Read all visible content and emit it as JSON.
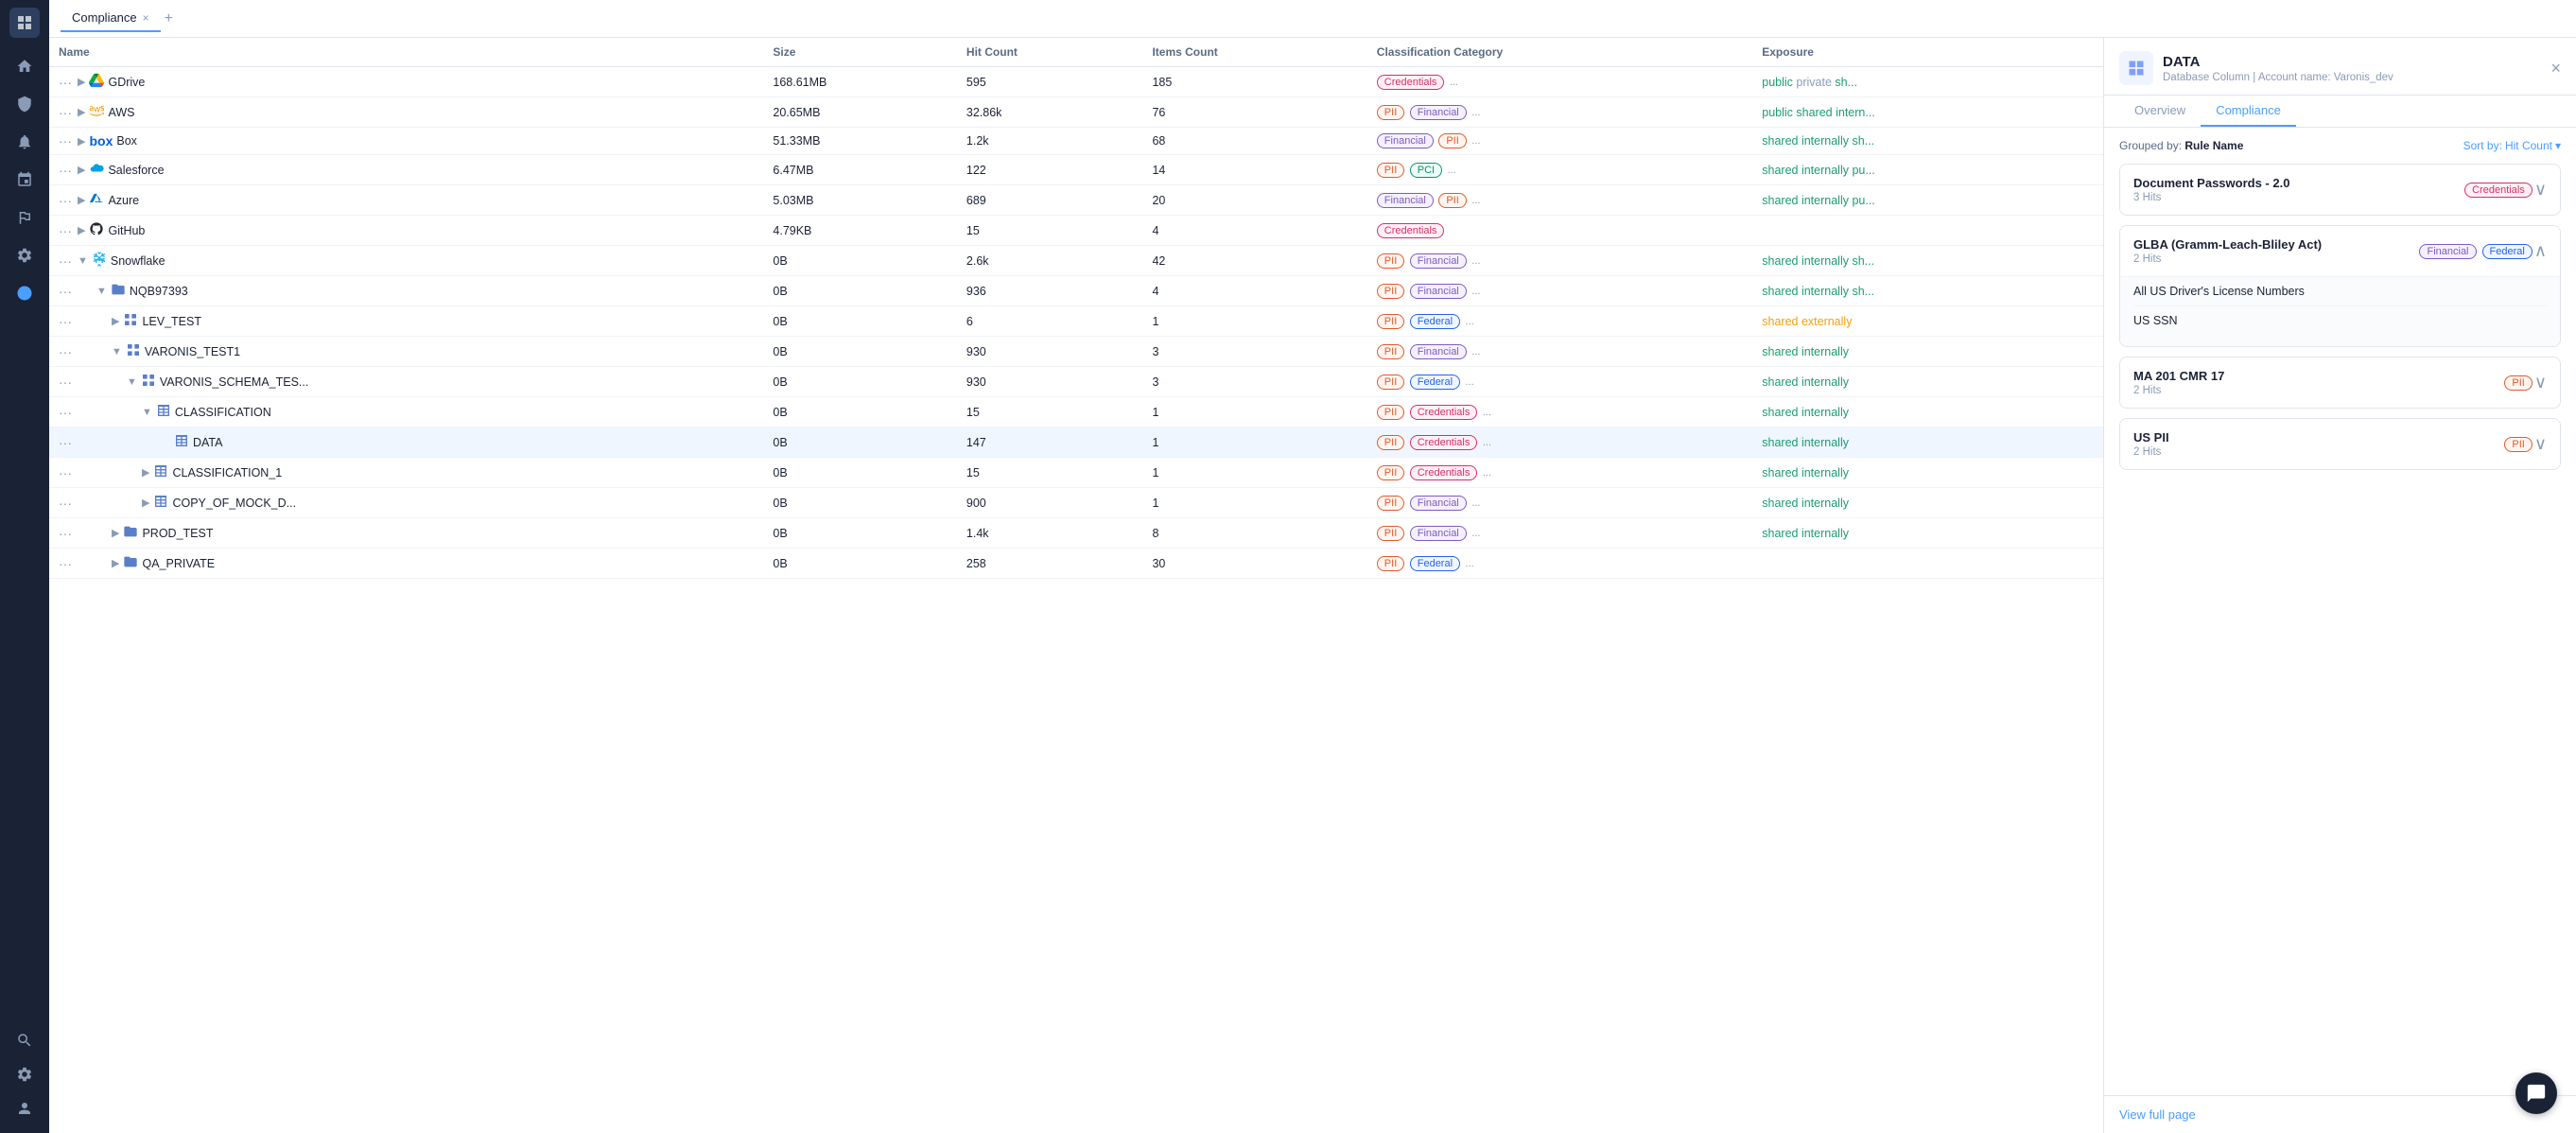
{
  "tab": {
    "label": "Compliance",
    "close": "×",
    "add": "+"
  },
  "table": {
    "columns": [
      "Name",
      "Size",
      "Hit Count",
      "Items Count",
      "Classification Category",
      "Exposure"
    ],
    "rows": [
      {
        "id": 1,
        "indent": 0,
        "expand": "▶",
        "icon": "gdrive",
        "name": "GDrive",
        "size": "168.61MB",
        "hitCount": "595",
        "itemsCount": "185",
        "tags": [
          {
            "label": "Credentials",
            "type": "credentials"
          },
          {
            "label": "...",
            "type": "more"
          }
        ],
        "exposure": [
          {
            "label": "public",
            "type": "public"
          },
          {
            "label": "private",
            "type": "private"
          },
          {
            "label": "sh...",
            "type": "shared-int"
          }
        ]
      },
      {
        "id": 2,
        "indent": 0,
        "expand": "▶",
        "icon": "aws",
        "name": "AWS",
        "size": "20.65MB",
        "hitCount": "32.86k",
        "itemsCount": "76",
        "tags": [
          {
            "label": "PII",
            "type": "pii"
          },
          {
            "label": "Financial",
            "type": "financial"
          },
          {
            "label": "...",
            "type": "more"
          }
        ],
        "exposure": [
          {
            "label": "public",
            "type": "public"
          },
          {
            "label": "shared intern...",
            "type": "shared-int"
          }
        ]
      },
      {
        "id": 3,
        "indent": 0,
        "expand": "▶",
        "icon": "box",
        "name": "Box",
        "size": "51.33MB",
        "hitCount": "1.2k",
        "itemsCount": "68",
        "tags": [
          {
            "label": "Financial",
            "type": "financial"
          },
          {
            "label": "PII",
            "type": "pii"
          },
          {
            "label": "...",
            "type": "more"
          }
        ],
        "exposure": [
          {
            "label": "shared internally",
            "type": "shared-int"
          },
          {
            "label": "sh...",
            "type": "shared-int"
          }
        ]
      },
      {
        "id": 4,
        "indent": 0,
        "expand": "▶",
        "icon": "salesforce",
        "name": "Salesforce",
        "size": "6.47MB",
        "hitCount": "122",
        "itemsCount": "14",
        "tags": [
          {
            "label": "PII",
            "type": "pii"
          },
          {
            "label": "PCI",
            "type": "pci"
          },
          {
            "label": "...",
            "type": "more"
          }
        ],
        "exposure": [
          {
            "label": "shared internally",
            "type": "shared-int"
          },
          {
            "label": "pu...",
            "type": "public"
          }
        ]
      },
      {
        "id": 5,
        "indent": 0,
        "expand": "▶",
        "icon": "azure",
        "name": "Azure",
        "size": "5.03MB",
        "hitCount": "689",
        "itemsCount": "20",
        "tags": [
          {
            "label": "Financial",
            "type": "financial"
          },
          {
            "label": "PII",
            "type": "pii"
          },
          {
            "label": "...",
            "type": "more"
          }
        ],
        "exposure": [
          {
            "label": "shared internally",
            "type": "shared-int"
          },
          {
            "label": "pu...",
            "type": "public"
          }
        ]
      },
      {
        "id": 6,
        "indent": 0,
        "expand": "▶",
        "icon": "github",
        "name": "GitHub",
        "size": "4.79KB",
        "hitCount": "15",
        "itemsCount": "4",
        "tags": [
          {
            "label": "Credentials",
            "type": "credentials"
          }
        ],
        "exposure": []
      },
      {
        "id": 7,
        "indent": 0,
        "expand": "▼",
        "icon": "snowflake",
        "name": "Snowflake",
        "size": "0B",
        "hitCount": "2.6k",
        "itemsCount": "42",
        "tags": [
          {
            "label": "PII",
            "type": "pii"
          },
          {
            "label": "Financial",
            "type": "financial"
          },
          {
            "label": "...",
            "type": "more"
          }
        ],
        "exposure": [
          {
            "label": "shared internally",
            "type": "shared-int"
          },
          {
            "label": "sh...",
            "type": "shared-int"
          }
        ]
      },
      {
        "id": 8,
        "indent": 1,
        "expand": "▼",
        "icon": "folder",
        "name": "NQB97393",
        "size": "0B",
        "hitCount": "936",
        "itemsCount": "4",
        "tags": [
          {
            "label": "PII",
            "type": "pii"
          },
          {
            "label": "Financial",
            "type": "financial"
          },
          {
            "label": "...",
            "type": "more"
          }
        ],
        "exposure": [
          {
            "label": "shared internally",
            "type": "shared-int"
          },
          {
            "label": "sh...",
            "type": "shared-int"
          }
        ]
      },
      {
        "id": 9,
        "indent": 2,
        "expand": "▶",
        "icon": "schema",
        "name": "LEV_TEST",
        "size": "0B",
        "hitCount": "6",
        "itemsCount": "1",
        "tags": [
          {
            "label": "PII",
            "type": "pii"
          },
          {
            "label": "Federal",
            "type": "federal"
          },
          {
            "label": "...",
            "type": "more"
          }
        ],
        "exposure": [
          {
            "label": "shared externally",
            "type": "shared-ext"
          }
        ]
      },
      {
        "id": 10,
        "indent": 2,
        "expand": "▼",
        "icon": "schema",
        "name": "VARONIS_TEST1",
        "size": "0B",
        "hitCount": "930",
        "itemsCount": "3",
        "tags": [
          {
            "label": "PII",
            "type": "pii"
          },
          {
            "label": "Financial",
            "type": "financial"
          },
          {
            "label": "...",
            "type": "more"
          }
        ],
        "exposure": [
          {
            "label": "shared internally",
            "type": "shared-int"
          }
        ]
      },
      {
        "id": 11,
        "indent": 3,
        "expand": "▼",
        "icon": "schema",
        "name": "VARONIS_SCHEMA_TES...",
        "size": "0B",
        "hitCount": "930",
        "itemsCount": "3",
        "tags": [
          {
            "label": "PII",
            "type": "pii"
          },
          {
            "label": "Federal",
            "type": "federal"
          },
          {
            "label": "...",
            "type": "more"
          }
        ],
        "exposure": [
          {
            "label": "shared internally",
            "type": "shared-int"
          }
        ]
      },
      {
        "id": 12,
        "indent": 4,
        "expand": "▼",
        "icon": "table",
        "name": "CLASSIFICATION",
        "size": "0B",
        "hitCount": "15",
        "itemsCount": "1",
        "tags": [
          {
            "label": "PII",
            "type": "pii"
          },
          {
            "label": "Credentials",
            "type": "credentials"
          },
          {
            "label": "...",
            "type": "more"
          }
        ],
        "exposure": [
          {
            "label": "shared internally",
            "type": "shared-int"
          }
        ]
      },
      {
        "id": 13,
        "indent": 5,
        "expand": "",
        "icon": "data",
        "name": "DATA",
        "size": "0B",
        "hitCount": "147",
        "itemsCount": "1",
        "tags": [
          {
            "label": "PII",
            "type": "pii"
          },
          {
            "label": "Credentials",
            "type": "credentials"
          },
          {
            "label": "...",
            "type": "more"
          }
        ],
        "exposure": [
          {
            "label": "shared internally",
            "type": "shared-int"
          }
        ],
        "selected": true
      },
      {
        "id": 14,
        "indent": 4,
        "expand": "▶",
        "icon": "table",
        "name": "CLASSIFICATION_1",
        "size": "0B",
        "hitCount": "15",
        "itemsCount": "1",
        "tags": [
          {
            "label": "PII",
            "type": "pii"
          },
          {
            "label": "Credentials",
            "type": "credentials"
          },
          {
            "label": "...",
            "type": "more"
          }
        ],
        "exposure": [
          {
            "label": "shared internally",
            "type": "shared-int"
          }
        ]
      },
      {
        "id": 15,
        "indent": 4,
        "expand": "▶",
        "icon": "table",
        "name": "COPY_OF_MOCK_D...",
        "size": "0B",
        "hitCount": "900",
        "itemsCount": "1",
        "tags": [
          {
            "label": "PII",
            "type": "pii"
          },
          {
            "label": "Financial",
            "type": "financial"
          },
          {
            "label": "...",
            "type": "more"
          }
        ],
        "exposure": [
          {
            "label": "shared internally",
            "type": "shared-int"
          }
        ]
      },
      {
        "id": 16,
        "indent": 2,
        "expand": "▶",
        "icon": "folder",
        "name": "PROD_TEST",
        "size": "0B",
        "hitCount": "1.4k",
        "itemsCount": "8",
        "tags": [
          {
            "label": "PII",
            "type": "pii"
          },
          {
            "label": "Financial",
            "type": "financial"
          },
          {
            "label": "...",
            "type": "more"
          }
        ],
        "exposure": [
          {
            "label": "shared internally",
            "type": "shared-int"
          }
        ]
      },
      {
        "id": 17,
        "indent": 2,
        "expand": "▶",
        "icon": "folder",
        "name": "QA_PRIVATE",
        "size": "0B",
        "hitCount": "258",
        "itemsCount": "30",
        "tags": [
          {
            "label": "PII",
            "type": "pii"
          },
          {
            "label": "Federal",
            "type": "federal"
          },
          {
            "label": "...",
            "type": "more"
          }
        ],
        "exposure": []
      }
    ]
  },
  "panel": {
    "title": "DATA",
    "subtitle_db": "Database Column",
    "subtitle_sep": "|",
    "subtitle_account": "Account name: Varonis_dev",
    "close": "×",
    "tabs": [
      {
        "label": "Overview",
        "active": false
      },
      {
        "label": "Compliance",
        "active": true
      }
    ],
    "toolbar": {
      "grouped_prefix": "Grouped by:",
      "grouped_value": "Rule Name",
      "sort_prefix": "Sort by:",
      "sort_value": "Hit Count"
    },
    "rules": [
      {
        "id": 1,
        "title": "Document Passwords - 2.0",
        "hits": "3 Hits",
        "tags": [
          {
            "label": "Credentials",
            "type": "credentials"
          }
        ],
        "expanded": false,
        "items": []
      },
      {
        "id": 2,
        "title": "GLBA (Gramm-Leach-Bliley Act)",
        "hits": "2 Hits",
        "tags": [
          {
            "label": "Financial",
            "type": "financial"
          },
          {
            "label": "Federal",
            "type": "federal"
          }
        ],
        "expanded": true,
        "items": [
          "All US Driver's License Numbers",
          "US SSN"
        ]
      },
      {
        "id": 3,
        "title": "MA 201 CMR 17",
        "hits": "2 Hits",
        "tags": [
          {
            "label": "PII",
            "type": "pii"
          }
        ],
        "expanded": false,
        "items": []
      },
      {
        "id": 4,
        "title": "US PII",
        "hits": "2 Hits",
        "tags": [
          {
            "label": "PII",
            "type": "pii"
          }
        ],
        "expanded": false,
        "items": []
      }
    ],
    "view_full_page": "View full page"
  },
  "sidebar": {
    "items": [
      {
        "icon": "home",
        "unicode": "⌂",
        "active": false
      },
      {
        "icon": "shield",
        "unicode": "🛡",
        "active": false
      },
      {
        "icon": "bell",
        "unicode": "🔔",
        "active": false
      },
      {
        "icon": "network",
        "unicode": "⬡",
        "active": false
      },
      {
        "icon": "list",
        "unicode": "☰",
        "active": false
      },
      {
        "icon": "settings-gear",
        "unicode": "⚙",
        "active": false
      },
      {
        "icon": "circle-active",
        "unicode": "●",
        "active": true
      },
      {
        "icon": "search",
        "unicode": "🔍",
        "active": false
      },
      {
        "icon": "settings",
        "unicode": "⚙",
        "active": false
      },
      {
        "icon": "user",
        "unicode": "👤",
        "active": false
      }
    ]
  }
}
